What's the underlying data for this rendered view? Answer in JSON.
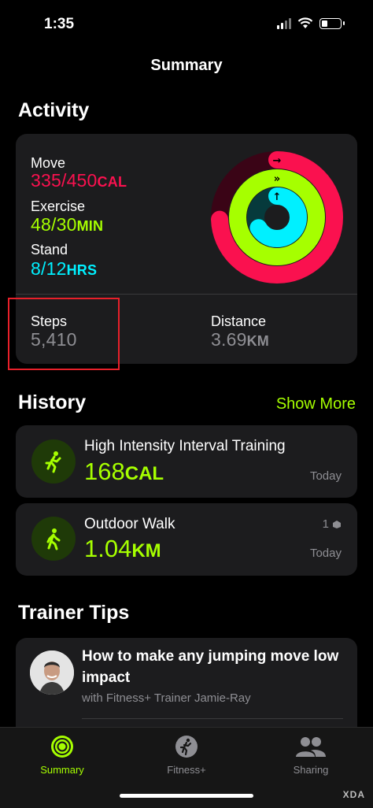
{
  "status_bar": {
    "time": "1:35"
  },
  "nav": {
    "title": "Summary"
  },
  "activity": {
    "section_title": "Activity",
    "move": {
      "label": "Move",
      "value": "335/450",
      "unit": "CAL"
    },
    "exercise": {
      "label": "Exercise",
      "value": "48/30",
      "unit": "MIN"
    },
    "stand": {
      "label": "Stand",
      "value": "8/12",
      "unit": "HRS"
    },
    "steps": {
      "label": "Steps",
      "value": "5,410"
    },
    "distance": {
      "label": "Distance",
      "value": "3.69",
      "unit": "KM"
    },
    "rings": {
      "move_progress": 0.744,
      "exercise_progress": 1.6,
      "stand_progress": 0.667
    },
    "colors": {
      "move": "#fa114f",
      "exercise": "#a6ff00",
      "stand": "#00f0ff"
    }
  },
  "history": {
    "section_title": "History",
    "show_more": "Show More",
    "items": [
      {
        "title": "High Intensity Interval Training",
        "value": "168",
        "unit": "CAL",
        "date": "Today",
        "icon": "hiit-icon"
      },
      {
        "title": "Outdoor Walk",
        "value": "1.04",
        "unit": "KM",
        "date": "Today",
        "badge": "1",
        "icon": "walk-icon"
      }
    ]
  },
  "trainer_tips": {
    "section_title": "Trainer Tips",
    "tip": {
      "title": "How to make any jumping move low impact",
      "subtitle": "with Fitness+ Trainer Jamie-Ray"
    }
  },
  "tabs": [
    {
      "label": "Summary",
      "icon": "activity-rings-icon",
      "active": true
    },
    {
      "label": "Fitness+",
      "icon": "runner-icon",
      "active": false
    },
    {
      "label": "Sharing",
      "icon": "people-icon",
      "active": false
    }
  ],
  "watermark": "XDA"
}
